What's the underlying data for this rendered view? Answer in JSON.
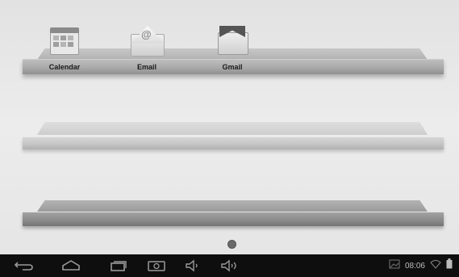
{
  "apps": [
    {
      "label": "Calendar",
      "icon": "calendar-icon"
    },
    {
      "label": "Email",
      "icon": "email-icon"
    },
    {
      "label": "Gmail",
      "icon": "gmail-icon"
    }
  ],
  "page_indicator": {
    "pages": 1,
    "current": 1
  },
  "navbar": {
    "buttons": [
      "back-icon",
      "home-icon",
      "recent-apps-icon",
      "screenshot-icon",
      "volume-down-icon",
      "volume-up-icon"
    ],
    "status": {
      "time": "08:06",
      "icons": [
        "image-notification-icon",
        "wifi-icon",
        "battery-icon"
      ]
    }
  },
  "colors": {
    "navbar": "#0e0e0e",
    "wallpaper": "#e6e6e6",
    "shelf": "#a9a9a9"
  }
}
